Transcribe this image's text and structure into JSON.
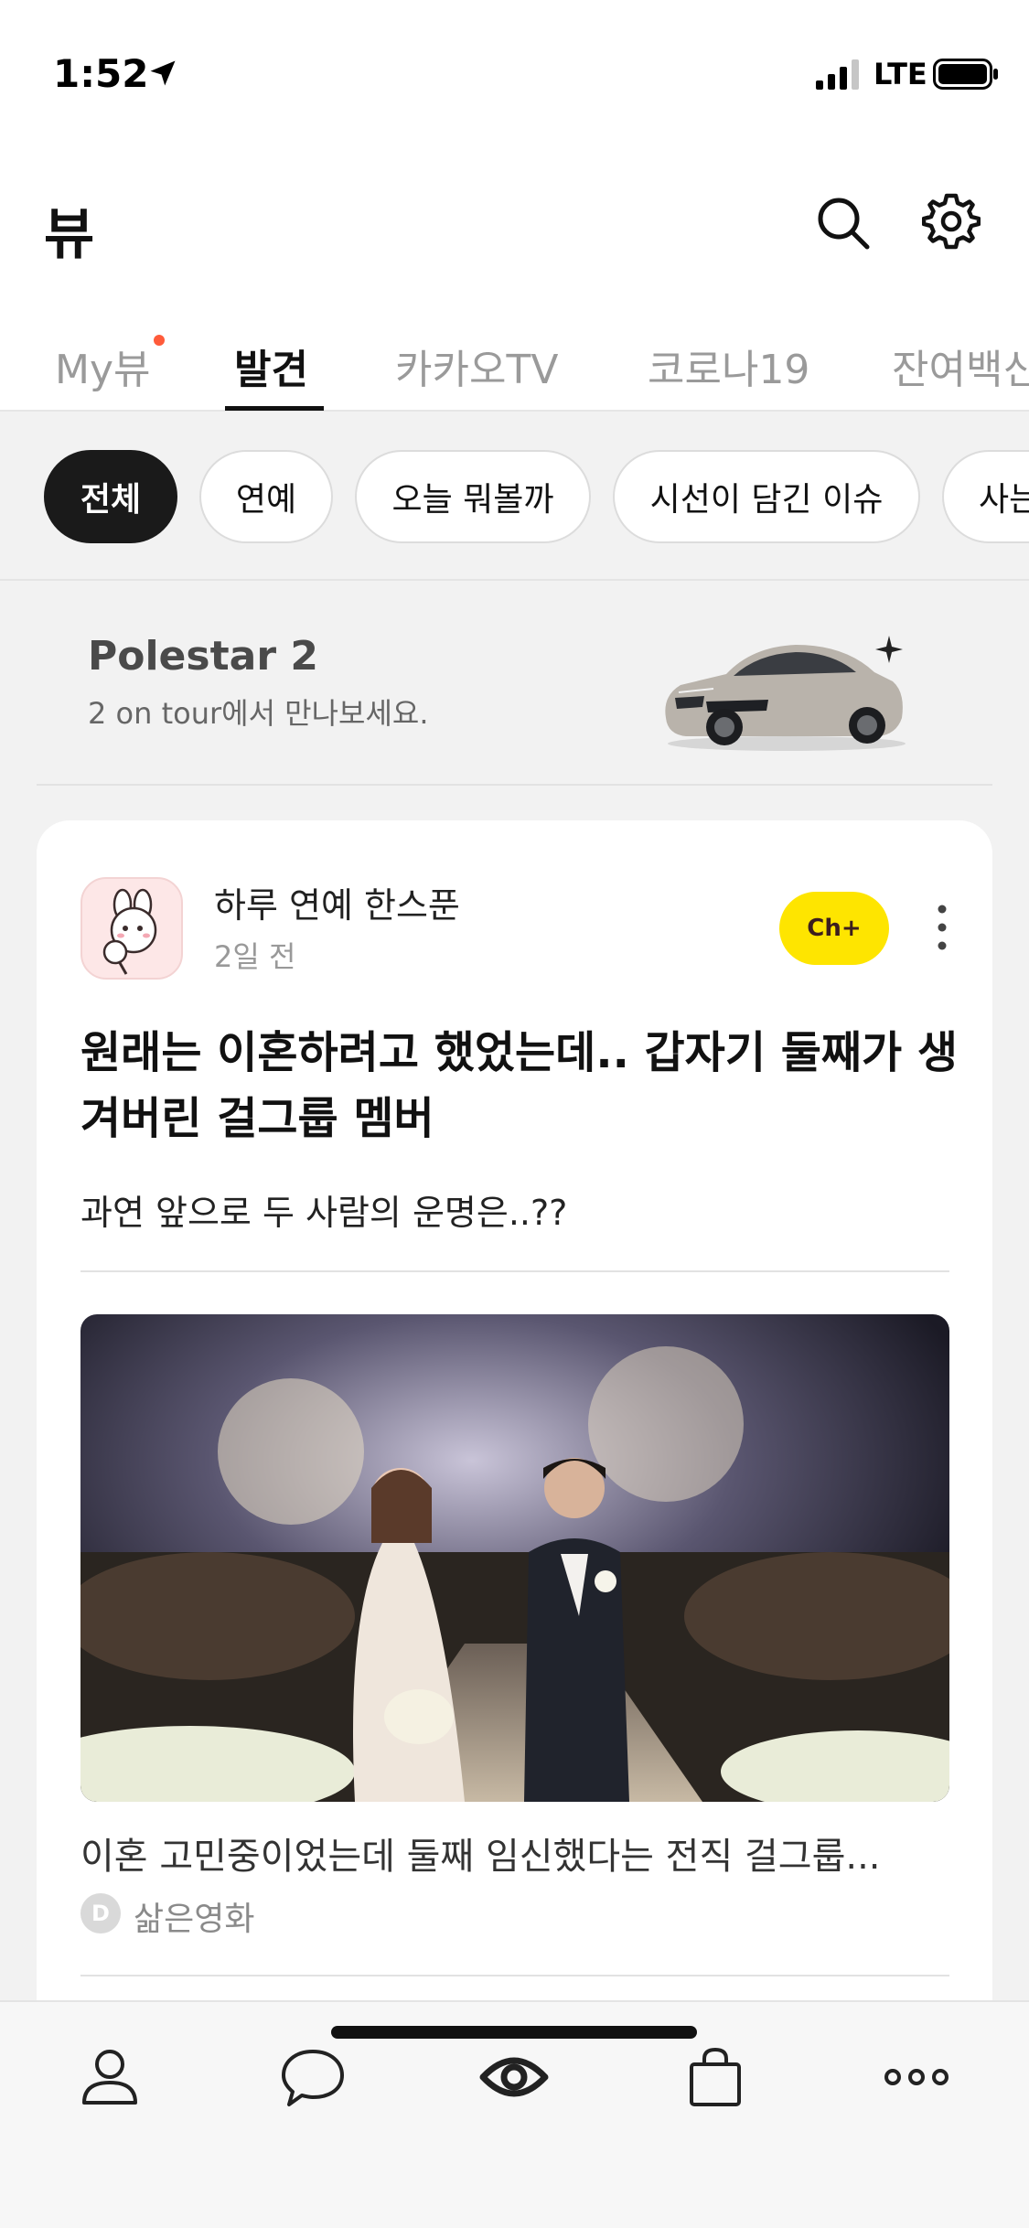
{
  "status_bar": {
    "time": "1:52",
    "network": "LTE"
  },
  "header": {
    "title": "뷰"
  },
  "tabs": [
    {
      "label": "My뷰",
      "active": false,
      "badge": true
    },
    {
      "label": "발견",
      "active": true
    },
    {
      "label": "카카오TV",
      "active": false
    },
    {
      "label": "코로나19",
      "active": false
    },
    {
      "label": "잔여백신",
      "active": false
    }
  ],
  "chips": [
    {
      "label": "전체",
      "active": true
    },
    {
      "label": "연예",
      "active": false
    },
    {
      "label": "오늘 뭐볼까",
      "active": false
    },
    {
      "label": "시선이 담긴 이슈",
      "active": false
    },
    {
      "label": "사는",
      "active": false
    }
  ],
  "ad": {
    "title": "Polestar 2",
    "subtitle": "2 on tour에서 만나보세요."
  },
  "card": {
    "channel_name": "하루 연예 한스푼",
    "time": "2일 전",
    "ch_plus_label": "Ch+",
    "headline": "원래는 이혼하려고 했었는데.. 갑자기 둘째가 생겨버린 걸그룹 멤버",
    "subtext": "과연 앞으로 두 사람의 운명은..??",
    "caption": "이혼 고민중이었는데 둘째 임신했다는 전직 걸그룹...",
    "source_name": "삶은영화",
    "source_icon_letter": "D"
  },
  "bottom_nav": [
    {
      "icon": "person-icon"
    },
    {
      "icon": "chat-bubble-icon"
    },
    {
      "icon": "view-eye-icon",
      "active": true
    },
    {
      "icon": "shopping-bag-icon"
    },
    {
      "icon": "more-horizontal-icon"
    }
  ]
}
